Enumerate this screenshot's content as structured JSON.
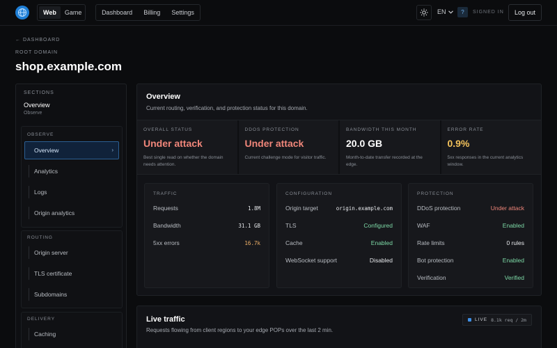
{
  "topbar": {
    "mode_options": [
      "Web",
      "Game"
    ],
    "nav": [
      "Dashboard",
      "Billing",
      "Settings"
    ],
    "language": "EN",
    "help": "?",
    "signed_in": "SIGNED IN",
    "logout": "Log out"
  },
  "header": {
    "back": "← DASHBOARD",
    "root_label": "ROOT DOMAIN",
    "domain": "shop.example.com"
  },
  "sidebar": {
    "sections_label": "SECTIONS",
    "current": "Overview",
    "current_sub": "Observe",
    "groups": [
      {
        "label": "OBSERVE",
        "items": [
          "Overview",
          "Analytics",
          "Logs",
          "Origin analytics"
        ]
      },
      {
        "label": "ROUTING",
        "items": [
          "Origin server",
          "TLS certificate",
          "Subdomains"
        ]
      },
      {
        "label": "DELIVERY",
        "items": [
          "Caching"
        ]
      }
    ],
    "active_chevron": "›"
  },
  "overview": {
    "title": "Overview",
    "subtitle": "Current routing, verification, and protection status for this domain.",
    "stats": [
      {
        "label": "OVERALL STATUS",
        "value": "Under attack",
        "desc": "Best single read on whether the domain needs attention."
      },
      {
        "label": "DDOS PROTECTION",
        "value": "Under attack",
        "desc": "Current challenge mode for visitor traffic."
      },
      {
        "label": "BANDWIDTH THIS MONTH",
        "value": "20.0 GB",
        "desc": "Month-to-date transfer recorded at the edge."
      },
      {
        "label": "ERROR RATE",
        "value": "0.9%",
        "desc": "5xx responses in the current analytics window."
      }
    ],
    "traffic": {
      "label": "TRAFFIC",
      "rows": [
        {
          "k": "Requests",
          "v": "1.8M"
        },
        {
          "k": "Bandwidth",
          "v": "31.1 GB"
        },
        {
          "k": "5xx errors",
          "v": "16.7k"
        }
      ]
    },
    "configuration": {
      "label": "CONFIGURATION",
      "rows": [
        {
          "k": "Origin target",
          "v": "origin.example.com"
        },
        {
          "k": "TLS",
          "v": "Configured"
        },
        {
          "k": "Cache",
          "v": "Enabled"
        },
        {
          "k": "WebSocket support",
          "v": "Disabled"
        }
      ]
    },
    "protection": {
      "label": "PROTECTION",
      "rows": [
        {
          "k": "DDoS protection",
          "v": "Under attack"
        },
        {
          "k": "WAF",
          "v": "Enabled"
        },
        {
          "k": "Rate limits",
          "v": "0 rules"
        },
        {
          "k": "Bot protection",
          "v": "Enabled"
        },
        {
          "k": "Verification",
          "v": "Verified"
        }
      ]
    }
  },
  "live": {
    "title": "Live traffic",
    "subtitle": "Requests flowing from client regions to your edge POPs over the last 2 min.",
    "badge_word": "LIVE",
    "rate": "8.1k req / 2m"
  },
  "colors": {
    "accent": "#1f7fd6",
    "danger": "#f0867a",
    "success": "#7dd9a6",
    "warning": "#f2c15a"
  }
}
